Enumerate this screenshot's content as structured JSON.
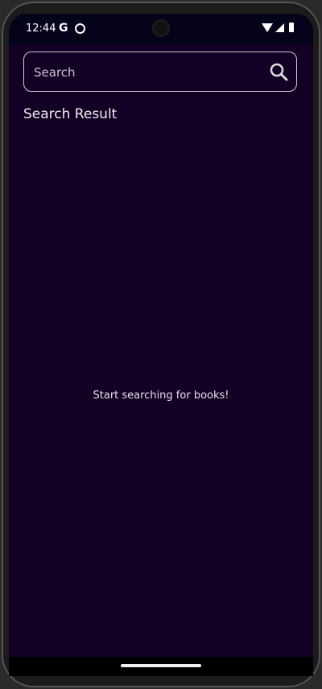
{
  "status_bar": {
    "time": "12:44",
    "google_icon": "G"
  },
  "search": {
    "placeholder": "Search",
    "value": "",
    "icon": "search-icon"
  },
  "section_title": "Search Result",
  "empty_message": "Start searching for books!",
  "colors": {
    "background": "#140024",
    "status_bar": "#05031a"
  }
}
